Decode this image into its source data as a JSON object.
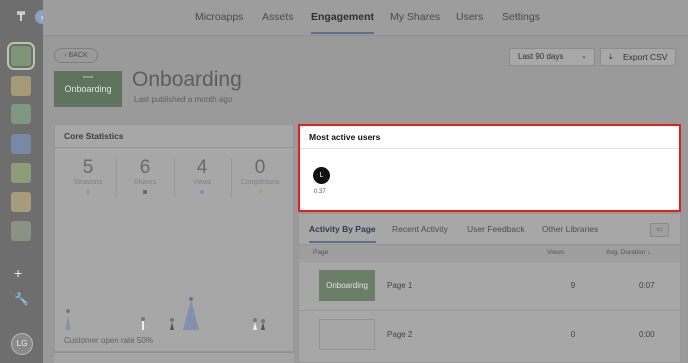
{
  "rail": {
    "logo": "₸",
    "expand": "›",
    "apps": [
      {
        "color": "#7e9479",
        "active": true
      },
      {
        "color": "#a59a78"
      },
      {
        "color": "#7f9780"
      },
      {
        "color": "#7889a6"
      },
      {
        "color": "#8f9c79"
      },
      {
        "color": "#a69b7b"
      },
      {
        "color": "#8a9283"
      }
    ],
    "add": "+",
    "avatar_initials": "LG"
  },
  "nav": {
    "tabs": [
      "Microapps",
      "Assets",
      "Engagement",
      "My Shares",
      "Users",
      "Settings"
    ],
    "active": "Engagement"
  },
  "header": {
    "back_label": "‹ BACK",
    "thumb_label": "Onboarding",
    "thumb_sub": "brand",
    "title": "Onboarding",
    "subtitle": "Last published a month ago",
    "range_label": "Last 90 days",
    "export_label": "Export CSV"
  },
  "core_stats": {
    "title": "Core Statistics",
    "stats": [
      {
        "value": "5",
        "label": "Sessions",
        "dot": "#9a9a9a"
      },
      {
        "value": "6",
        "label": "Shares",
        "dot": "#6e6e6e"
      },
      {
        "value": "4",
        "label": "Views",
        "dot": "#7f8fb0"
      },
      {
        "value": "0",
        "label": "Completions",
        "dot": "#8fae85"
      }
    ],
    "open_rate": "Customer open rate 50%"
  },
  "most_active_users": {
    "title": "Most active users",
    "users": [
      {
        "initial": "L",
        "value": "0.37"
      }
    ]
  },
  "activity": {
    "tabs": [
      "Activity By Page",
      "Recent Activity",
      "User Feedback",
      "Other Libraries"
    ],
    "active": "Activity By Page",
    "columns": {
      "page": "Page",
      "views": "Views",
      "duration": "Avg. Duration ↓"
    },
    "rows": [
      {
        "thumb": "Onboarding",
        "name": "Page 1",
        "views": "9",
        "duration": "0:07"
      },
      {
        "thumb": "",
        "name": "Page 2",
        "views": "0",
        "duration": "0:00"
      }
    ]
  }
}
